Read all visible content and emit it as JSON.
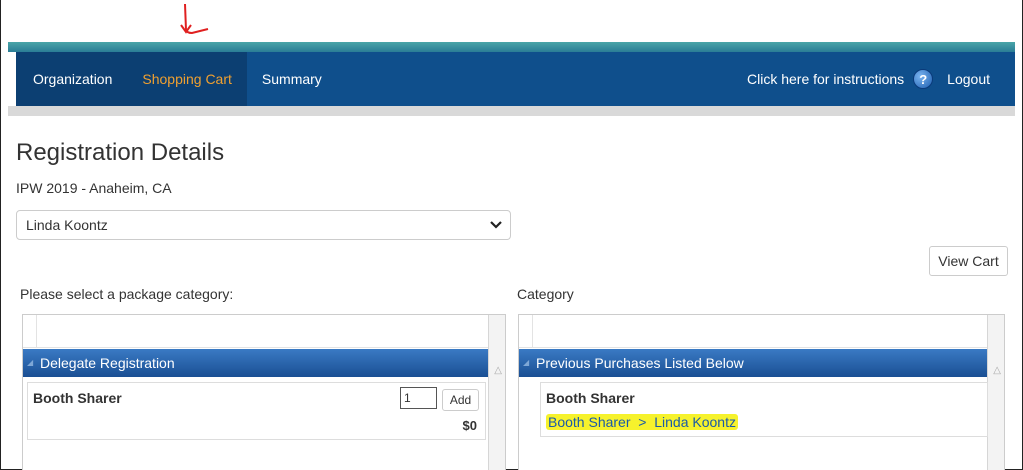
{
  "nav": {
    "items": [
      "Organization",
      "Shopping Cart",
      "Summary"
    ],
    "active": "Shopping Cart",
    "instructions": "Click here for instructions",
    "help_glyph": "?",
    "logout": "Logout"
  },
  "page": {
    "title": "Registration Details",
    "event": "IPW 2019 - Anaheim, CA",
    "attendee_select": "Linda Koontz",
    "view_cart": "View Cart"
  },
  "left_panel": {
    "label": "Please select a package category:",
    "category": "Delegate Registration",
    "item_name": "Booth Sharer",
    "quantity": "1",
    "add_label": "Add",
    "price": "$0"
  },
  "right_panel": {
    "label": "Category",
    "category": "Previous Purchases Listed Below",
    "item_name": "Booth Sharer",
    "purchase": "Booth Sharer  >  Linda Koontz"
  },
  "colors": {
    "nav_bg": "#0f4f8c",
    "active_tab": "#f0a030",
    "highlight": "#f6f22c",
    "annotation_arrow": "#e02020"
  },
  "icons": [
    "annotation-arrow-icon",
    "help-icon",
    "chevron-down-icon",
    "collapse-triangle-icon",
    "scroll-up-icon"
  ]
}
